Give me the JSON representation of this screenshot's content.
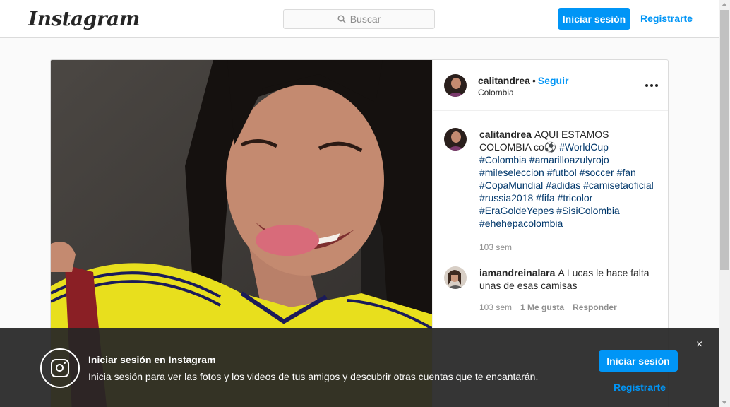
{
  "nav": {
    "logo": "Instagram",
    "search_placeholder": "Buscar",
    "login_label": "Iniciar sesión",
    "register_label": "Registrarte"
  },
  "post": {
    "header": {
      "username": "calitandrea",
      "dot": "•",
      "follow_label": "Seguir",
      "location": "Colombia"
    },
    "caption": {
      "username": "calitandrea",
      "text": "AQUI ESTAMOS COLOMBIA co⚽",
      "hashtags": [
        "#WorldCup",
        "#Colombia",
        "#amarilloazulyrojo",
        "#mileseleccion",
        "#futbol",
        "#soccer",
        "#fan",
        "#CopaMundial",
        "#adidas",
        "#camisetaoficial",
        "#russia2018",
        "#fifa",
        "#tricolor",
        "#EraGoldeYepes",
        "#SisiColombia",
        "#ehehepacolombia"
      ],
      "time": "103 sem"
    },
    "comments": [
      {
        "username": "iamandreinalara",
        "text": "A Lucas le hace falta unas de esas camisas",
        "time": "103 sem",
        "likes": "1 Me gusta",
        "reply": "Responder"
      }
    ]
  },
  "banner": {
    "title": "Iniciar sesión en Instagram",
    "text": "Inicia sesión para ver las fotos y los videos de tus amigos y descubrir otras cuentas que te encantarán.",
    "login_label": "Iniciar sesión",
    "register_label": "Registrarte",
    "close_label": "×"
  },
  "colors": {
    "accent": "#0095f6",
    "hashtag": "#00376b",
    "banner_bg": "#262626"
  }
}
